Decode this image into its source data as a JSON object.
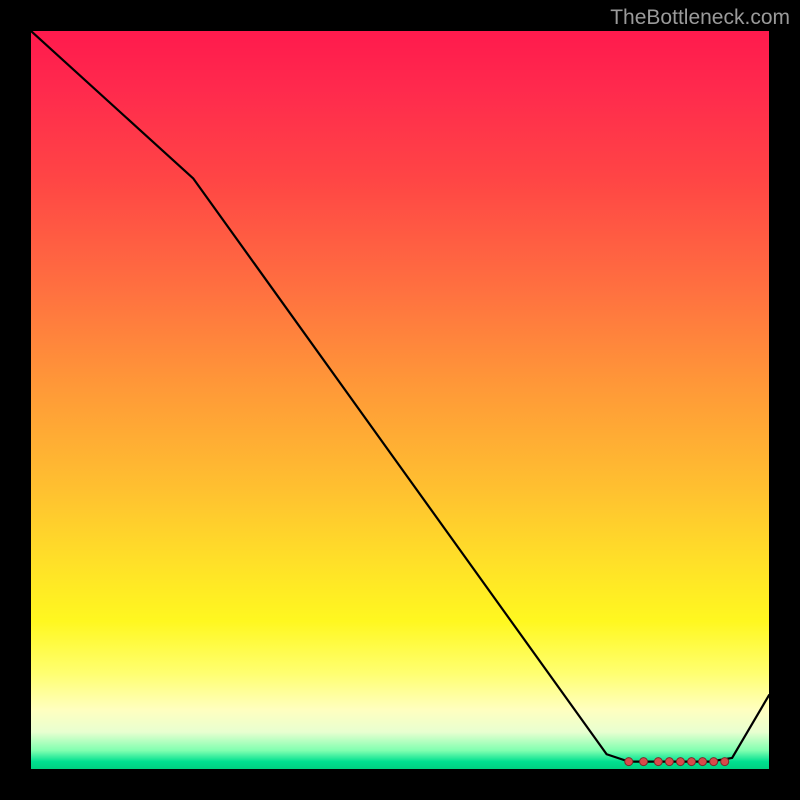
{
  "watermark": "TheBottleneck.com",
  "chart_data": {
    "type": "line",
    "title": "",
    "xlabel": "",
    "ylabel": "",
    "xlim": [
      0,
      100
    ],
    "ylim": [
      0,
      100
    ],
    "grid": false,
    "x": [
      0,
      22,
      78,
      81,
      84,
      88,
      92,
      95,
      100
    ],
    "values": [
      100,
      80,
      2,
      1,
      1,
      1,
      1,
      1.5,
      10
    ],
    "markers": [
      {
        "x": 81,
        "y": 1
      },
      {
        "x": 83,
        "y": 1
      },
      {
        "x": 85,
        "y": 1
      },
      {
        "x": 86.5,
        "y": 1
      },
      {
        "x": 88,
        "y": 1
      },
      {
        "x": 89.5,
        "y": 1
      },
      {
        "x": 91,
        "y": 1
      },
      {
        "x": 92.5,
        "y": 1
      },
      {
        "x": 94,
        "y": 1
      }
    ],
    "colors": {
      "line": "#000000",
      "marker_fill": "#d84a4a",
      "marker_stroke": "#7a2a2a"
    }
  }
}
